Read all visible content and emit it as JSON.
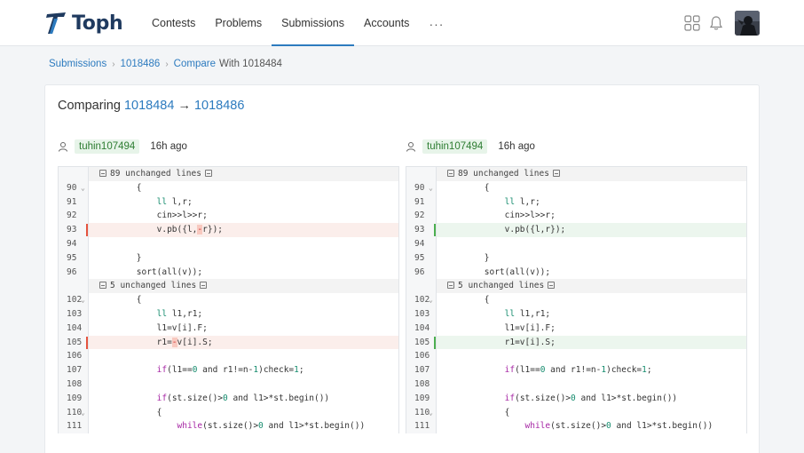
{
  "brand": {
    "name": "Toph"
  },
  "nav": {
    "items": [
      {
        "label": "Contests",
        "active": false
      },
      {
        "label": "Problems",
        "active": false
      },
      {
        "label": "Submissions",
        "active": true
      },
      {
        "label": "Accounts",
        "active": false
      }
    ],
    "more": "···",
    "icons": [
      "apps-grid-icon",
      "bell-icon"
    ]
  },
  "breadcrumb": {
    "root": "Submissions",
    "middle": "1018486",
    "current_link": "Compare",
    "current_text": "With 1018484"
  },
  "card": {
    "title_prefix": "Comparing",
    "from_id": "1018484",
    "arrow": "→",
    "to_id": "1018486"
  },
  "left": {
    "user": "tuhin107494",
    "ago": "16h ago"
  },
  "right": {
    "user": "tuhin107494",
    "ago": "16h ago"
  },
  "diff": {
    "fold1": "89 unchanged lines",
    "fold2": "5 unchanged lines",
    "lines1": [
      "90",
      "91",
      "92",
      "93",
      "94",
      "95",
      "96"
    ],
    "lines2": [
      "102",
      "103",
      "104",
      "105",
      "106",
      "107",
      "108",
      "109",
      "110",
      "111"
    ],
    "left_code1": [
      "        {",
      "            ll l,r;",
      "            cin>>l>>r;",
      "            v.pb({l,-r});",
      "",
      "        }",
      "        sort(all(v));"
    ],
    "right_code1": [
      "        {",
      "            ll l,r;",
      "            cin>>l>>r;",
      "            v.pb({l,r});",
      "",
      "        }",
      "        sort(all(v));"
    ],
    "left_code2": [
      "        {",
      "            ll l1,r1;",
      "            l1=v[i].F;",
      "            r1=-v[i].S;",
      "",
      "            if(l1==0 and r1!=n-1)check=1;",
      "",
      "            if(st.size()>0 and l1>*st.begin())",
      "            {",
      "                while(st.size()>0 and l1>*st.begin())"
    ],
    "right_code2": [
      "        {",
      "            ll l1,r1;",
      "            l1=v[i].F;",
      "            r1=v[i].S;",
      "",
      "            if(l1==0 and r1!=n-1)check=1;",
      "",
      "            if(st.size()>0 and l1>*st.begin())",
      "            {",
      "                while(st.size()>0 and l1>*st.begin())"
    ]
  }
}
